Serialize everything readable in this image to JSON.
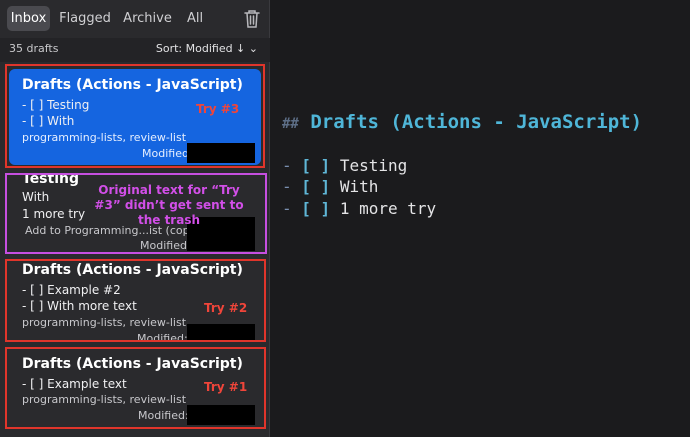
{
  "tabs": [
    {
      "label": "Inbox",
      "active": true
    },
    {
      "label": "Flagged",
      "active": false
    },
    {
      "label": "Archive",
      "active": false
    },
    {
      "label": "All",
      "active": false
    }
  ],
  "list": {
    "count": "35 drafts",
    "sort": "Sort: Modified ↓ ⌄"
  },
  "cards": [
    {
      "title": "Drafts (Actions - JavaScript)",
      "lines": [
        "- [ ] Testing",
        "- [ ] With"
      ],
      "tags": "programming-lists, review-list",
      "modified": "Modified:"
    },
    {
      "title": "Testing",
      "lines": [
        "With",
        "1 more try"
      ],
      "tags": "Add to Programming...ist (copy):",
      "modified": "Modified:"
    },
    {
      "title": "Drafts (Actions - JavaScript)",
      "lines": [
        "- [ ] Example #2",
        "- [ ] With more text"
      ],
      "tags": "programming-lists, review-list",
      "modified": "Modified:"
    },
    {
      "title": "Drafts (Actions - JavaScript)",
      "lines": [
        "- [ ] Example text"
      ],
      "tags": "programming-lists, review-list",
      "modified": "Modified:"
    }
  ],
  "annotations": {
    "try3": "Try #3",
    "try2": "Try #2",
    "try1": "Try #1",
    "original_note": "Original text for “Try #3” didn’t get sent to the trash"
  },
  "editor": {
    "heading_marker": "##",
    "heading": "Drafts (Actions - JavaScript)",
    "lines": [
      {
        "dash": "-",
        "box": "[ ]",
        "text": "Testing"
      },
      {
        "dash": "-",
        "box": "[ ]",
        "text": "With"
      },
      {
        "dash": "-",
        "box": "[ ]",
        "text": "1 more try"
      }
    ]
  },
  "colors": {
    "accent": "#1565e0",
    "red_outline": "#e0352b",
    "purple_outline": "#c64fe0",
    "heading": "#4fb6d8",
    "annotation_red": "#f0453a",
    "annotation_purple": "#d24fe8"
  }
}
